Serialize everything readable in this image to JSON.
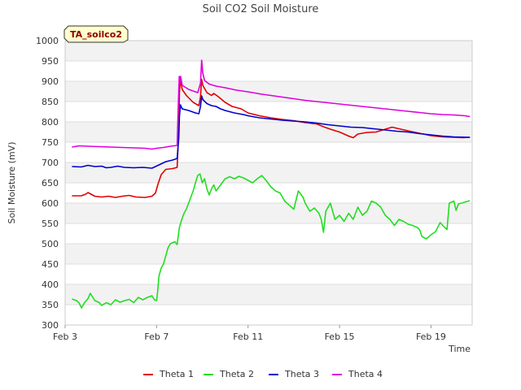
{
  "chart_data": {
    "type": "line",
    "title": "Soil CO2 Soil Moisture",
    "badge": "TA_soilco2",
    "xlabel": "Time",
    "ylabel": "Soil Moisture (mV)",
    "ylim": [
      300,
      1000
    ],
    "yticks": [
      300,
      350,
      400,
      450,
      500,
      550,
      600,
      650,
      700,
      750,
      800,
      850,
      900,
      950,
      1000
    ],
    "xlim": [
      3,
      20.8
    ],
    "xticks": [
      {
        "x": 3,
        "label": "Feb 3"
      },
      {
        "x": 7,
        "label": "Feb 7"
      },
      {
        "x": 11,
        "label": "Feb 11"
      },
      {
        "x": 15,
        "label": "Feb 15"
      },
      {
        "x": 19,
        "label": "Feb 19"
      }
    ],
    "grid": true,
    "legend_position": "bottom",
    "series": [
      {
        "name": "Theta 1",
        "color": "#e00000",
        "points": [
          [
            3.3,
            618
          ],
          [
            3.7,
            618
          ],
          [
            3.9,
            622
          ],
          [
            4.0,
            626
          ],
          [
            4.3,
            617
          ],
          [
            4.6,
            615
          ],
          [
            4.9,
            617
          ],
          [
            5.2,
            614
          ],
          [
            5.5,
            617
          ],
          [
            5.8,
            619
          ],
          [
            6.1,
            615
          ],
          [
            6.5,
            614
          ],
          [
            6.8,
            617
          ],
          [
            6.95,
            625
          ],
          [
            7.05,
            645
          ],
          [
            7.2,
            670
          ],
          [
            7.4,
            683
          ],
          [
            7.7,
            685
          ],
          [
            7.9,
            688
          ],
          [
            7.97,
            780
          ],
          [
            8.0,
            870
          ],
          [
            8.04,
            905
          ],
          [
            8.12,
            880
          ],
          [
            8.3,
            865
          ],
          [
            8.6,
            848
          ],
          [
            8.85,
            840
          ],
          [
            8.92,
            862
          ],
          [
            8.97,
            905
          ],
          [
            9.02,
            890
          ],
          [
            9.2,
            872
          ],
          [
            9.4,
            865
          ],
          [
            9.5,
            870
          ],
          [
            9.7,
            862
          ],
          [
            10.0,
            848
          ],
          [
            10.3,
            838
          ],
          [
            10.7,
            832
          ],
          [
            11.0,
            822
          ],
          [
            11.5,
            815
          ],
          [
            12.0,
            810
          ],
          [
            12.5,
            806
          ],
          [
            13.0,
            803
          ],
          [
            13.5,
            798
          ],
          [
            14.0,
            795
          ],
          [
            14.3,
            788
          ],
          [
            14.6,
            782
          ],
          [
            15.0,
            775
          ],
          [
            15.4,
            765
          ],
          [
            15.6,
            761
          ],
          [
            15.8,
            770
          ],
          [
            16.2,
            774
          ],
          [
            16.6,
            775
          ],
          [
            17.0,
            782
          ],
          [
            17.3,
            787
          ],
          [
            17.6,
            783
          ],
          [
            18.0,
            778
          ],
          [
            18.5,
            772
          ],
          [
            19.0,
            766
          ],
          [
            19.5,
            763
          ],
          [
            20.0,
            762
          ],
          [
            20.4,
            761
          ],
          [
            20.7,
            762
          ]
        ]
      },
      {
        "name": "Theta 2",
        "color": "#22dd22",
        "points": [
          [
            3.3,
            364
          ],
          [
            3.5,
            360
          ],
          [
            3.6,
            355
          ],
          [
            3.72,
            342
          ],
          [
            3.85,
            355
          ],
          [
            4.0,
            365
          ],
          [
            4.1,
            378
          ],
          [
            4.3,
            360
          ],
          [
            4.5,
            355
          ],
          [
            4.6,
            348
          ],
          [
            4.8,
            355
          ],
          [
            5.0,
            350
          ],
          [
            5.2,
            362
          ],
          [
            5.4,
            356
          ],
          [
            5.6,
            360
          ],
          [
            5.8,
            363
          ],
          [
            6.0,
            355
          ],
          [
            6.2,
            368
          ],
          [
            6.4,
            362
          ],
          [
            6.6,
            368
          ],
          [
            6.8,
            372
          ],
          [
            6.9,
            362
          ],
          [
            7.0,
            360
          ],
          [
            7.05,
            385
          ],
          [
            7.1,
            420
          ],
          [
            7.2,
            440
          ],
          [
            7.3,
            450
          ],
          [
            7.4,
            470
          ],
          [
            7.5,
            490
          ],
          [
            7.6,
            500
          ],
          [
            7.8,
            505
          ],
          [
            7.9,
            498
          ],
          [
            8.0,
            540
          ],
          [
            8.1,
            560
          ],
          [
            8.2,
            575
          ],
          [
            8.3,
            585
          ],
          [
            8.4,
            600
          ],
          [
            8.5,
            615
          ],
          [
            8.6,
            630
          ],
          [
            8.7,
            650
          ],
          [
            8.8,
            668
          ],
          [
            8.9,
            672
          ],
          [
            9.0,
            650
          ],
          [
            9.1,
            660
          ],
          [
            9.2,
            635
          ],
          [
            9.3,
            620
          ],
          [
            9.4,
            635
          ],
          [
            9.5,
            645
          ],
          [
            9.6,
            630
          ],
          [
            9.8,
            645
          ],
          [
            10.0,
            660
          ],
          [
            10.2,
            665
          ],
          [
            10.4,
            660
          ],
          [
            10.6,
            666
          ],
          [
            10.8,
            662
          ],
          [
            11.0,
            656
          ],
          [
            11.2,
            650
          ],
          [
            11.4,
            660
          ],
          [
            11.6,
            668
          ],
          [
            11.8,
            655
          ],
          [
            12.0,
            640
          ],
          [
            12.2,
            630
          ],
          [
            12.4,
            625
          ],
          [
            12.6,
            605
          ],
          [
            12.8,
            595
          ],
          [
            13.0,
            585
          ],
          [
            13.2,
            630
          ],
          [
            13.4,
            615
          ],
          [
            13.5,
            600
          ],
          [
            13.7,
            580
          ],
          [
            13.9,
            588
          ],
          [
            14.1,
            575
          ],
          [
            14.2,
            560
          ],
          [
            14.3,
            528
          ],
          [
            14.4,
            580
          ],
          [
            14.6,
            600
          ],
          [
            14.8,
            560
          ],
          [
            15.0,
            570
          ],
          [
            15.2,
            555
          ],
          [
            15.4,
            575
          ],
          [
            15.6,
            560
          ],
          [
            15.8,
            590
          ],
          [
            16.0,
            570
          ],
          [
            16.2,
            580
          ],
          [
            16.4,
            605
          ],
          [
            16.6,
            600
          ],
          [
            16.8,
            590
          ],
          [
            17.0,
            570
          ],
          [
            17.2,
            560
          ],
          [
            17.4,
            545
          ],
          [
            17.6,
            560
          ],
          [
            17.8,
            555
          ],
          [
            18.0,
            548
          ],
          [
            18.2,
            545
          ],
          [
            18.4,
            540
          ],
          [
            18.5,
            535
          ],
          [
            18.6,
            518
          ],
          [
            18.8,
            512
          ],
          [
            19.0,
            522
          ],
          [
            19.2,
            530
          ],
          [
            19.4,
            552
          ],
          [
            19.6,
            540
          ],
          [
            19.7,
            535
          ],
          [
            19.8,
            600
          ],
          [
            20.0,
            605
          ],
          [
            20.1,
            582
          ],
          [
            20.2,
            598
          ],
          [
            20.4,
            601
          ],
          [
            20.5,
            603
          ],
          [
            20.7,
            606
          ]
        ]
      },
      {
        "name": "Theta 3",
        "color": "#0000cc",
        "points": [
          [
            3.3,
            690
          ],
          [
            3.7,
            689
          ],
          [
            4.0,
            693
          ],
          [
            4.3,
            690
          ],
          [
            4.6,
            691
          ],
          [
            4.8,
            687
          ],
          [
            5.0,
            688
          ],
          [
            5.3,
            691
          ],
          [
            5.6,
            688
          ],
          [
            6.0,
            687
          ],
          [
            6.4,
            688
          ],
          [
            6.8,
            686
          ],
          [
            7.1,
            694
          ],
          [
            7.4,
            702
          ],
          [
            7.7,
            706
          ],
          [
            7.9,
            710
          ],
          [
            7.97,
            760
          ],
          [
            8.0,
            812
          ],
          [
            8.04,
            842
          ],
          [
            8.12,
            832
          ],
          [
            8.4,
            828
          ],
          [
            8.7,
            822
          ],
          [
            8.85,
            820
          ],
          [
            8.92,
            838
          ],
          [
            8.97,
            864
          ],
          [
            9.02,
            855
          ],
          [
            9.2,
            845
          ],
          [
            9.4,
            840
          ],
          [
            9.6,
            838
          ],
          [
            9.8,
            832
          ],
          [
            10.0,
            828
          ],
          [
            10.4,
            822
          ],
          [
            10.8,
            818
          ],
          [
            11.0,
            815
          ],
          [
            11.5,
            810
          ],
          [
            12.0,
            807
          ],
          [
            12.5,
            804
          ],
          [
            13.0,
            802
          ],
          [
            13.5,
            800
          ],
          [
            14.0,
            797
          ],
          [
            14.5,
            793
          ],
          [
            15.0,
            790
          ],
          [
            15.5,
            787
          ],
          [
            16.0,
            786
          ],
          [
            16.5,
            783
          ],
          [
            17.0,
            780
          ],
          [
            17.5,
            777
          ],
          [
            18.0,
            775
          ],
          [
            18.5,
            771
          ],
          [
            19.0,
            768
          ],
          [
            19.5,
            765
          ],
          [
            20.0,
            763
          ],
          [
            20.7,
            762
          ]
        ]
      },
      {
        "name": "Theta 4",
        "color": "#dd00dd",
        "points": [
          [
            3.3,
            738
          ],
          [
            3.6,
            741
          ],
          [
            4.0,
            740
          ],
          [
            4.5,
            739
          ],
          [
            5.0,
            738
          ],
          [
            5.5,
            737
          ],
          [
            6.0,
            736
          ],
          [
            6.5,
            735
          ],
          [
            6.8,
            733
          ],
          [
            7.0,
            735
          ],
          [
            7.3,
            737
          ],
          [
            7.6,
            740
          ],
          [
            7.9,
            742
          ],
          [
            7.95,
            840
          ],
          [
            7.99,
            912
          ],
          [
            8.02,
            895
          ],
          [
            8.05,
            912
          ],
          [
            8.12,
            890
          ],
          [
            8.4,
            880
          ],
          [
            8.8,
            872
          ],
          [
            8.92,
            895
          ],
          [
            8.97,
            952
          ],
          [
            9.02,
            920
          ],
          [
            9.1,
            902
          ],
          [
            9.3,
            893
          ],
          [
            9.6,
            888
          ],
          [
            10.0,
            884
          ],
          [
            10.5,
            878
          ],
          [
            11.0,
            874
          ],
          [
            11.5,
            869
          ],
          [
            12.0,
            865
          ],
          [
            12.5,
            861
          ],
          [
            13.0,
            857
          ],
          [
            13.5,
            853
          ],
          [
            14.0,
            850
          ],
          [
            14.5,
            847
          ],
          [
            15.0,
            844
          ],
          [
            15.5,
            841
          ],
          [
            16.0,
            838
          ],
          [
            16.5,
            835
          ],
          [
            17.0,
            832
          ],
          [
            17.5,
            829
          ],
          [
            18.0,
            826
          ],
          [
            18.5,
            823
          ],
          [
            19.0,
            820
          ],
          [
            19.5,
            818
          ],
          [
            20.0,
            817
          ],
          [
            20.5,
            815
          ],
          [
            20.7,
            813
          ]
        ]
      }
    ]
  }
}
